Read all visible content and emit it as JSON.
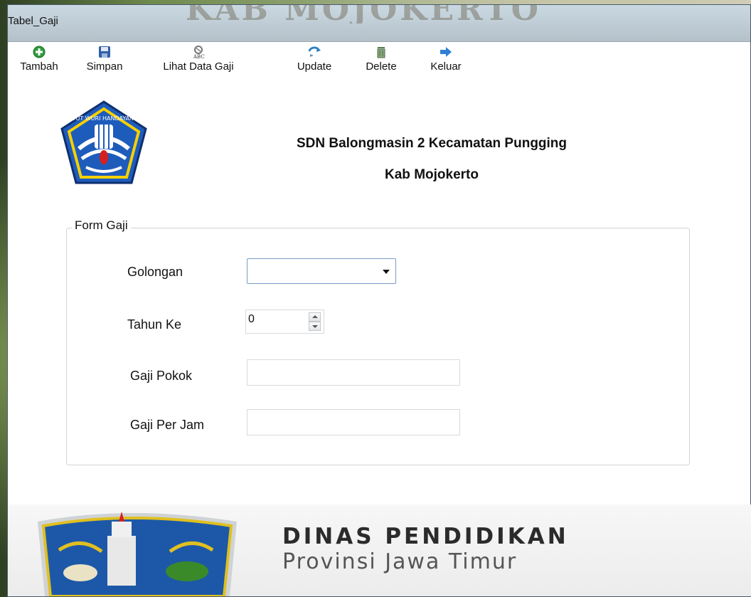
{
  "window": {
    "title": "Tabel_Gaji",
    "background_wordmark": "KAB MOJOKERTO"
  },
  "toolbar": {
    "items": [
      {
        "label": "Tambah",
        "icon": "add-icon"
      },
      {
        "label": "Simpan",
        "icon": "save-icon"
      },
      {
        "label": "Lihat Data Gaji",
        "icon": "view-data-icon"
      },
      {
        "label": "Update",
        "icon": "update-icon"
      },
      {
        "label": "Delete",
        "icon": "delete-icon"
      },
      {
        "label": "Keluar",
        "icon": "exit-arrow-icon"
      }
    ]
  },
  "header": {
    "line1": "SDN Balongmasin 2 Kecamatan Pungging",
    "line2": "Kab Mojokerto",
    "logo_text": "TUT WURI HANDAYANI"
  },
  "form": {
    "group_title": "Form Gaji",
    "golongan_label": "Golongan",
    "golongan_value": "",
    "tahun_label": "Tahun Ke",
    "tahun_value": "0",
    "gaji_pokok_label": "Gaji Pokok",
    "gaji_pokok_value": "",
    "gaji_per_jam_label": "Gaji Per Jam",
    "gaji_per_jam_value": ""
  },
  "banner": {
    "line1": "DINAS PENDIDIKAN",
    "line2": "Provinsi Jawa Timur"
  },
  "colors": {
    "accent_blue": "#1f5fbf",
    "add_green": "#2e9c3a",
    "banner_text": "#2b2b2b"
  }
}
